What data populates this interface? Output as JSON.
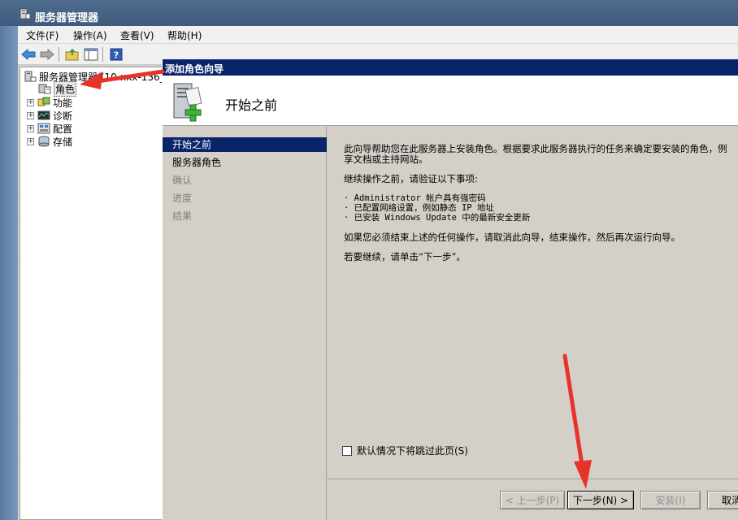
{
  "window": {
    "title": "服务器管理器"
  },
  "menu": {
    "items": [
      {
        "label": "文件(F)"
      },
      {
        "label": "操作(A)"
      },
      {
        "label": "查看(V)"
      },
      {
        "label": "帮助(H)"
      }
    ]
  },
  "toolbar": {
    "icons": [
      "back-arrow-icon",
      "forward-arrow-icon",
      "up-folder-icon",
      "show-hide-tree-icon",
      "help-icon"
    ]
  },
  "tree": {
    "root_label": "服务器管理器 (10-xxx-136_",
    "items": [
      {
        "label": "角色",
        "selected": true
      },
      {
        "label": "功能"
      },
      {
        "label": "诊断"
      },
      {
        "label": "配置"
      },
      {
        "label": "存储"
      }
    ]
  },
  "wizard": {
    "title": "添加角色向导",
    "header_title": "开始之前",
    "nav": [
      {
        "label": "开始之前",
        "state": "active"
      },
      {
        "label": "服务器角色",
        "state": "done"
      },
      {
        "label": "确认",
        "state": "disabled"
      },
      {
        "label": "进度",
        "state": "disabled"
      },
      {
        "label": "结果",
        "state": "disabled"
      }
    ],
    "content": {
      "intro_line1": "此向导帮助您在此服务器上安装角色。根据要求此服务器执行的任务来确定要安装的角色，例",
      "intro_line2": "享文档或主持网站。",
      "verify_heading": "继续操作之前，请验证以下事项:",
      "bullet1": "· Administrator 帐户具有强密码",
      "bullet2": "· 已配置网络设置，例如静态 IP 地址",
      "bullet3": "· 已安装 Windows Update 中的最新安全更新",
      "cancel_note": "如果您必须结束上述的任何操作，请取消此向导，结束操作，然后再次运行向导。",
      "continue_note": "若要继续，请单击“下一步”。"
    },
    "skip_checkbox_label": "默认情况下将跳过此页(S)",
    "skip_checked": false,
    "buttons": {
      "prev": "< 上一步(P)",
      "next": "下一步(N) >",
      "install": "安装(I)",
      "cancel": "取消"
    }
  },
  "colors": {
    "annotation_arrow": "#e8332a",
    "wizard_title_bg": "#0a246a",
    "nav_active_bg": "#0a246a"
  }
}
